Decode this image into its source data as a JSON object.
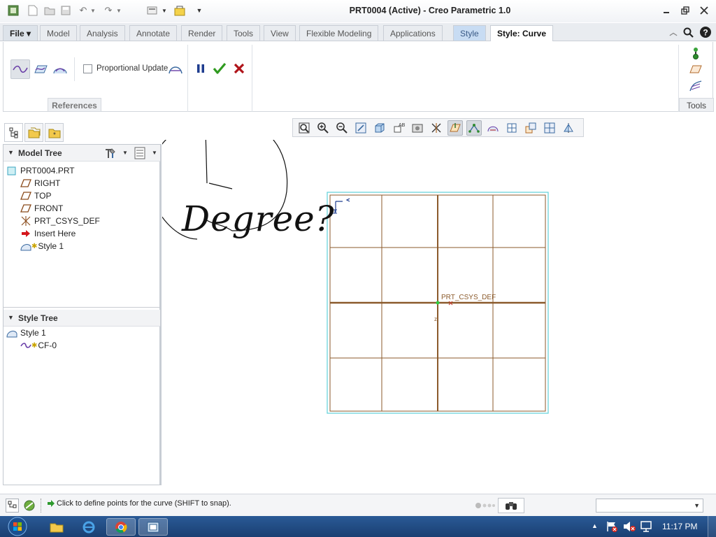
{
  "window": {
    "title": "PRT0004 (Active) - Creo Parametric 1.0"
  },
  "ribbon": {
    "tabs": [
      {
        "label": "File",
        "kind": "file"
      },
      {
        "label": "Model"
      },
      {
        "label": "Analysis"
      },
      {
        "label": "Annotate"
      },
      {
        "label": "Render"
      },
      {
        "label": "Tools"
      },
      {
        "label": "View"
      },
      {
        "label": "Flexible Modeling"
      },
      {
        "label": "Applications"
      },
      {
        "label": "Style",
        "kind": "style"
      },
      {
        "label": "Style: Curve",
        "kind": "active"
      }
    ],
    "proportional_update": "Proportional Update",
    "proportional_checked": false,
    "references_label": "References",
    "tools_label": "Tools"
  },
  "navigator": {
    "model_tree": {
      "title": "Model Tree",
      "root": "PRT0004.PRT",
      "items": [
        {
          "label": "RIGHT",
          "icon": "datum-plane-icon"
        },
        {
          "label": "TOP",
          "icon": "datum-plane-icon"
        },
        {
          "label": "FRONT",
          "icon": "datum-plane-icon"
        },
        {
          "label": "PRT_CSYS_DEF",
          "icon": "csys-icon"
        },
        {
          "label": "Insert Here",
          "icon": "insert-arrow-icon"
        },
        {
          "label": "Style 1",
          "icon": "style-feature-icon"
        }
      ]
    },
    "style_tree": {
      "title": "Style Tree",
      "root": "Style 1",
      "items": [
        {
          "label": "CF-0",
          "icon": "curve-icon"
        }
      ]
    }
  },
  "graphics": {
    "csys_label": "PRT_CSYS_DEF",
    "annotation": "Degree?",
    "grid_color": "#8b5a2b",
    "border_color": "#5fd0d8"
  },
  "status": {
    "message": "Click to define points for the curve (SHIFT to snap)."
  },
  "taskbar": {
    "time": "11:17 PM"
  }
}
